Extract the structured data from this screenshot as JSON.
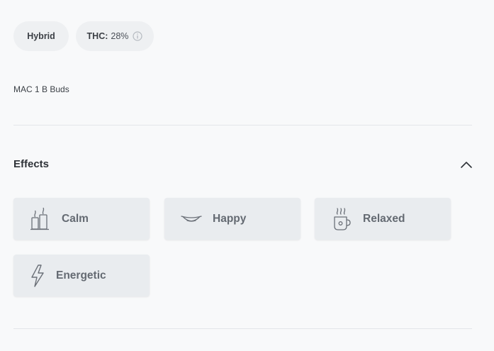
{
  "pills": {
    "strain_type": "Hybrid",
    "thc_label": "THC:",
    "thc_value": "28%"
  },
  "product": {
    "description": "MAC 1 B Buds"
  },
  "effects": {
    "title": "Effects",
    "items": [
      {
        "label": "Calm",
        "icon": "candles-icon"
      },
      {
        "label": "Happy",
        "icon": "smile-icon"
      },
      {
        "label": "Relaxed",
        "icon": "hot-cup-icon"
      },
      {
        "label": "Energetic",
        "icon": "lightning-icon"
      }
    ]
  }
}
